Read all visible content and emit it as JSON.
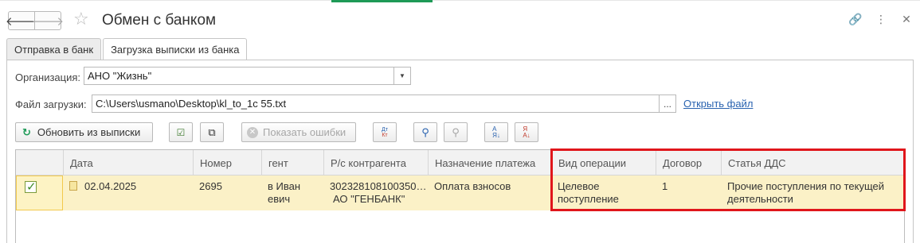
{
  "window": {
    "title": "Обмен с банком",
    "back_icon": "arrow-left-icon",
    "forward_icon": "arrow-right-icon",
    "favorite_icon": "star-icon",
    "link_icon": "link-icon",
    "menu_icon": "more-icon",
    "close_icon": "close-icon",
    "accent": "#1e9a57"
  },
  "tabs": [
    {
      "label": "Отправка в банк"
    },
    {
      "label": "Загрузка выписки из банка"
    }
  ],
  "form": {
    "org_label": "Организация:",
    "org_value": "АНО \"Жизнь\"",
    "file_label": "Файл загрузки:",
    "file_value": "C:\\Users\\usmano\\Desktop\\kl_to_1c 55.txt",
    "file_browse": "...",
    "open_file_link": "Открыть файл"
  },
  "toolbar": {
    "refresh_label": "Обновить из выписки",
    "show_errors_label": "Показать ошибки",
    "icons": [
      "check-all-icon",
      "copy-icon",
      "dt-kt-icon",
      "find-icon",
      "find-disabled-icon",
      "sort-asc-icon",
      "sort-desc-icon"
    ]
  },
  "table": {
    "columns": [
      "Дата",
      "Номер",
      "гент",
      "Р/с контрагента",
      "Назначение платежа",
      "Вид операции",
      "Договор",
      "Статья ДДС"
    ],
    "rows": [
      {
        "checked": true,
        "date": "02.04.2025",
        "number": "2695",
        "agent_line1": "в Иван",
        "agent_line2": "евич",
        "account_line1": "302328108100350…",
        "account_line2": "АО \"ГЕНБАНК\"",
        "purpose": "Оплата взносов",
        "operation_line1": "Целевое",
        "operation_line2": "поступление",
        "contract": "1",
        "dds_line1": "Прочие поступления по текущей",
        "dds_line2": "деятельности"
      }
    ]
  },
  "highlight_color": "#e0161b"
}
